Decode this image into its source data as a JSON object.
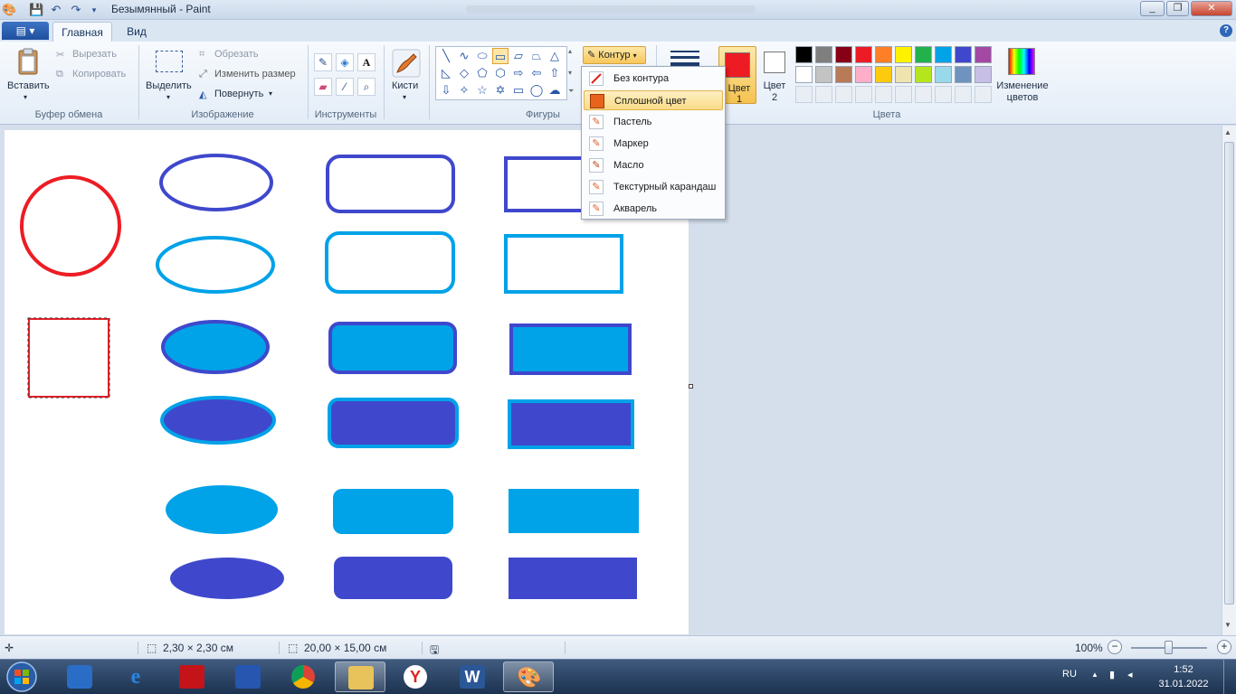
{
  "window": {
    "title": "Безымянный - Paint"
  },
  "tabs": {
    "app_menu": "▤ ▾",
    "home": "Главная",
    "view": "Вид"
  },
  "clipboard": {
    "paste": "Вставить",
    "cut": "Вырезать",
    "copy": "Копировать",
    "group": "Буфер обмена"
  },
  "image": {
    "select": "Выделить",
    "crop": "Обрезать",
    "resize": "Изменить размер",
    "rotate": "Повернуть",
    "group": "Изображение"
  },
  "tools": {
    "group": "Инструменты"
  },
  "brushes": {
    "label": "Кисти"
  },
  "shapes": {
    "group": "Фигуры",
    "outline": "Контур"
  },
  "colors": {
    "color1": "Цвет\n1",
    "color1_short": "Цвет",
    "color1_num": "1",
    "color2_a": "Цвет",
    "color2_b": "2",
    "edit_a": "Изменение",
    "edit_b": "цветов",
    "group": "Цвета",
    "color1_value": "#ed1c24",
    "palette_row1": [
      "#000000",
      "#7f7f7f",
      "#880015",
      "#ed1c24",
      "#ff7f27",
      "#fff200",
      "#22b14c",
      "#00a2e8",
      "#3f48cc",
      "#a349a4"
    ],
    "palette_row2": [
      "#ffffff",
      "#c3c3c3",
      "#b97a57",
      "#ffaec9",
      "#ffc90e",
      "#efe4b0",
      "#b5e61d",
      "#99d9ea",
      "#7092be",
      "#c8bfe7"
    ]
  },
  "outline_menu": {
    "items": [
      "Без контура",
      "Сплошной цвет",
      "Пастель",
      "Маркер",
      "Масло",
      "Текстурный карандаш",
      "Акварель"
    ],
    "selected_index": 1
  },
  "status": {
    "selection_size": "2,30 × 2,30 см",
    "canvas_size": "20,00 × 15,00 см",
    "zoom": "100%"
  },
  "tray": {
    "lang": "RU",
    "time": "1:52",
    "date": "31.01.2022"
  }
}
